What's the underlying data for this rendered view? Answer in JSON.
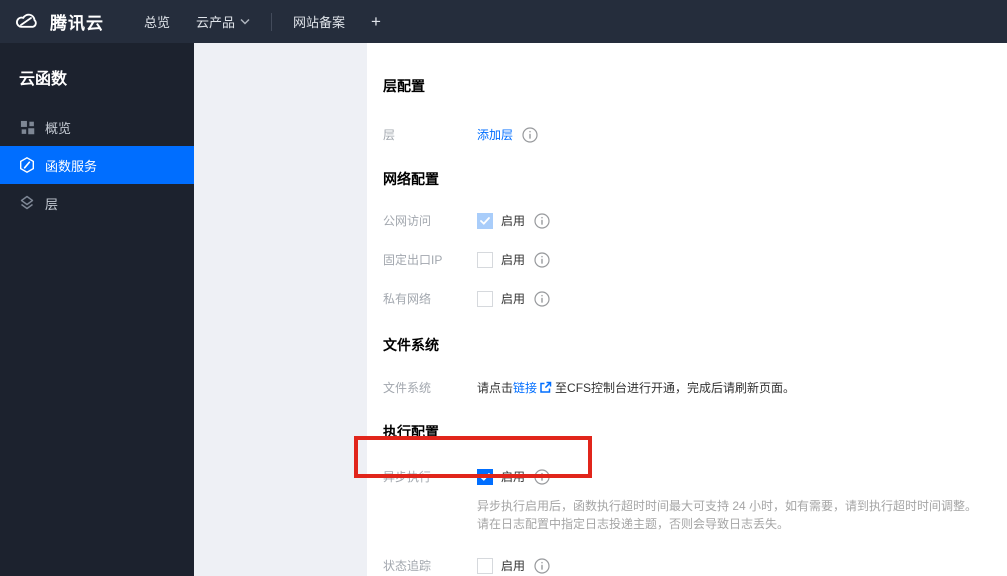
{
  "navbar": {
    "brand": "腾讯云",
    "items": [
      {
        "label": "总览"
      },
      {
        "label": "云产品"
      },
      {
        "label": "网站备案"
      },
      {
        "label": "+"
      }
    ]
  },
  "sidebar": {
    "title": "云函数",
    "items": [
      {
        "label": "概览",
        "icon": "grid-icon",
        "active": false
      },
      {
        "label": "函数服务",
        "icon": "function-icon",
        "active": true
      },
      {
        "label": "层",
        "icon": "layers-icon",
        "active": false
      }
    ]
  },
  "main": {
    "section_layer": {
      "title": "层配置",
      "label": "层",
      "link": "添加层"
    },
    "section_network": {
      "title": "网络配置",
      "rows": [
        {
          "label": "公网访问",
          "value": "启用",
          "state": "checked-disabled"
        },
        {
          "label": "固定出口IP",
          "value": "启用",
          "state": "unchecked"
        },
        {
          "label": "私有网络",
          "value": "启用",
          "state": "unchecked"
        }
      ]
    },
    "section_fs": {
      "title": "文件系统",
      "label": "文件系统",
      "text_before": "请点击",
      "link": "链接",
      "text_after": "至CFS控制台进行开通，完成后请刷新页面。"
    },
    "section_exec": {
      "title": "执行配置",
      "async_label": "异步执行",
      "async_value": "启用",
      "async_state": "checked",
      "hint_line1": "异步执行启用后，函数执行超时时间最大可支持 24 小时，如有需要，请到执行超时时间调整。",
      "hint_line2": "请在日志配置中指定日志投递主题，否则会导致日志丢失。",
      "trace_label": "状态追踪",
      "trace_value": "启用",
      "trace_state": "unchecked"
    }
  },
  "colors": {
    "accent_blue": "#006eff",
    "navbar_bg": "#252d3c",
    "sidebar_bg": "#1c222e",
    "gutter_bg": "#eef0f5",
    "annotation_red": "#e1251b",
    "disabled_check_blue": "#a9cdfa"
  }
}
